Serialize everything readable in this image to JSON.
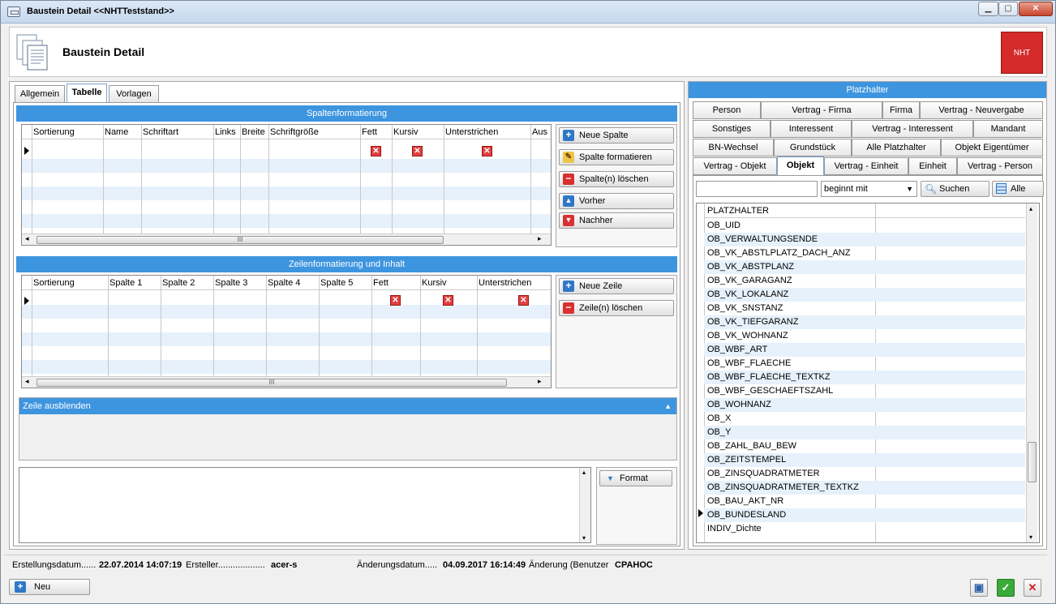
{
  "window": {
    "title": "Baustein Detail  <<NHTTeststand>>",
    "controls": {
      "minimize": "▁",
      "restore": "▢",
      "close": "✕"
    }
  },
  "header": {
    "title": "Baustein Detail",
    "badge": "NHT"
  },
  "left_tabs": [
    "Allgemein",
    "Tabelle",
    "Vorlagen"
  ],
  "spalten": {
    "title": "Spaltenformatierung",
    "columns": [
      "Sortierung",
      "Name",
      "Schriftart",
      "Links",
      "Breite",
      "Schriftgröße",
      "Fett",
      "Kursiv",
      "Unterstrichen",
      "Aus"
    ],
    "buttons": [
      "Neue Spalte",
      "Spalte formatieren",
      "Spalte(n) löschen",
      "Vorher",
      "Nachher"
    ],
    "scroll_grip": "III"
  },
  "zeilen": {
    "title": "Zeilenformatierung und Inhalt",
    "columns": [
      "Sortierung",
      "Spalte 1",
      "Spalte 2",
      "Spalte 3",
      "Spalte 4",
      "Spalte 5",
      "Fett",
      "Kursiv",
      "Unterstrichen"
    ],
    "buttons": [
      "Neue Zeile",
      "Zeile(n) löschen"
    ],
    "scroll_grip": "III"
  },
  "zeile_ausblenden": {
    "title": "Zeile ausblenden",
    "toggle": "▲"
  },
  "format_button": "Format",
  "platzhalter": {
    "title": "Platzhalter",
    "tab_rows": [
      [
        "Person",
        "Vertrag - Firma",
        "Firma",
        "Vertrag - Neuvergabe"
      ],
      [
        "Sonstiges",
        "Interessent",
        "Vertrag - Interessent",
        "Mandant"
      ],
      [
        "BN-Wechsel",
        "Grundstück",
        "Alle Platzhalter",
        "Objekt Eigentümer"
      ],
      [
        "Vertrag - Objekt",
        "Objekt",
        "Vertrag - Einheit",
        "Einheit",
        "Vertrag - Person"
      ]
    ],
    "active_tab": "Objekt",
    "search": {
      "value": "",
      "mode": "beginnt mit",
      "search_label": "Suchen",
      "all_label": "Alle"
    },
    "list_header": "PLATZHALTER",
    "items": [
      "OB_UID",
      "OB_VERWALTUNGSENDE",
      "OB_VK_ABSTLPLATZ_DACH_ANZ",
      "OB_VK_ABSTPLANZ",
      "OB_VK_GARAGANZ",
      "OB_VK_LOKALANZ",
      "OB_VK_SNSTANZ",
      "OB_VK_TIEFGARANZ",
      "OB_VK_WOHNANZ",
      "OB_WBF_ART",
      "OB_WBF_FLAECHE",
      "OB_WBF_FLAECHE_TEXTKZ",
      "OB_WBF_GESCHAEFTSZAHL",
      "OB_WOHNANZ",
      "OB_X",
      "OB_Y",
      "OB_ZAHL_BAU_BEW",
      "OB_ZEITSTEMPEL",
      "OB_ZINSQUADRATMETER",
      "OB_ZINSQUADRATMETER_TEXTKZ",
      "OB_BAU_AKT_NR",
      "OB_BUNDESLAND",
      "INDIV_Dichte"
    ]
  },
  "status": {
    "created_label": "Erstellungsdatum......",
    "created_value": "22.07.2014 14:07:19",
    "creator_label": "Ersteller...................",
    "creator_value": "acer-s",
    "changed_label": "Änderungsdatum.....",
    "changed_value": "04.09.2017 16:14:49",
    "changer_label": "Änderung (Benutzer",
    "changer_value": "CPAHOC"
  },
  "bottom": {
    "new_label": "Neu"
  },
  "colors": {
    "accent": "#3e95df",
    "badge": "#d42a2a"
  }
}
